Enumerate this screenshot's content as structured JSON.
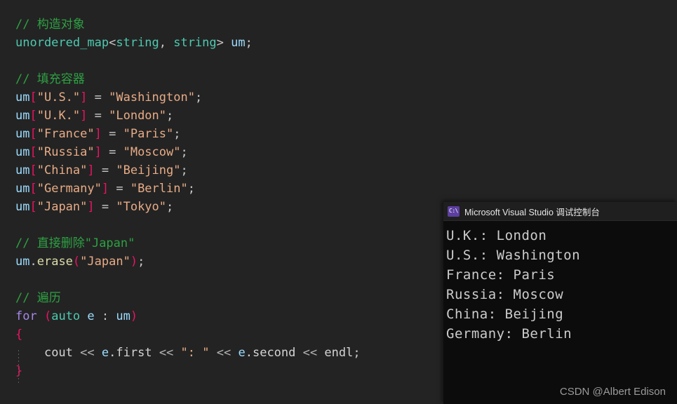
{
  "editor": {
    "language": "cpp",
    "background_color": "#232323",
    "lines": [
      {
        "id": "l1",
        "type": "comment",
        "text": "// 构造对象"
      },
      {
        "id": "l2",
        "type": "code",
        "text": "unordered_map<string, string> um;"
      },
      {
        "id": "l3",
        "type": "blank",
        "text": ""
      },
      {
        "id": "l4",
        "type": "comment",
        "text": "// 填充容器"
      },
      {
        "id": "l5",
        "type": "code",
        "text": "um[\"U.S.\"] = \"Washington\";"
      },
      {
        "id": "l6",
        "type": "code",
        "text": "um[\"U.K.\"] = \"London\";"
      },
      {
        "id": "l7",
        "type": "code",
        "text": "um[\"France\"] = \"Paris\";"
      },
      {
        "id": "l8",
        "type": "code",
        "text": "um[\"Russia\"] = \"Moscow\";"
      },
      {
        "id": "l9",
        "type": "code",
        "text": "um[\"China\"] = \"Beijing\";"
      },
      {
        "id": "l10",
        "type": "code",
        "text": "um[\"Germany\"] = \"Berlin\";"
      },
      {
        "id": "l11",
        "type": "code",
        "text": "um[\"Japan\"] = \"Tokyo\";"
      },
      {
        "id": "l12",
        "type": "blank",
        "text": ""
      },
      {
        "id": "l13",
        "type": "comment",
        "text": "// 直接删除\"Japan\""
      },
      {
        "id": "l14",
        "type": "code",
        "text": "um.erase(\"Japan\");"
      },
      {
        "id": "l15",
        "type": "blank",
        "text": ""
      },
      {
        "id": "l16",
        "type": "comment",
        "text": "// 遍历"
      },
      {
        "id": "l17",
        "type": "code",
        "text": "for (auto e : um)"
      },
      {
        "id": "l18",
        "type": "code",
        "text": "{"
      },
      {
        "id": "l19",
        "type": "code",
        "text": "    cout << e.first << \": \" << e.second << endl;"
      },
      {
        "id": "l20",
        "type": "code",
        "text": "}"
      }
    ],
    "tokens": {
      "l1": [
        {
          "t": "// ",
          "c": "t-comment"
        },
        {
          "t": "构造对象",
          "c": "t-comment"
        }
      ],
      "l2": [
        {
          "t": "unordered_map",
          "c": "t-type"
        },
        {
          "t": "<",
          "c": "t-punct"
        },
        {
          "t": "string",
          "c": "t-type"
        },
        {
          "t": ", ",
          "c": "t-punct"
        },
        {
          "t": "string",
          "c": "t-type"
        },
        {
          "t": "> ",
          "c": "t-punct"
        },
        {
          "t": "um",
          "c": "t-var"
        },
        {
          "t": ";",
          "c": "t-punct"
        }
      ],
      "l4": [
        {
          "t": "// ",
          "c": "t-comment"
        },
        {
          "t": "填充容器",
          "c": "t-comment"
        }
      ],
      "l5": [
        {
          "t": "um",
          "c": "t-var"
        },
        {
          "t": "[",
          "c": "t-bracket"
        },
        {
          "t": "\"U.S.\"",
          "c": "t-string"
        },
        {
          "t": "]",
          "c": "t-bracket"
        },
        {
          "t": " = ",
          "c": "t-punct"
        },
        {
          "t": "\"Washington\"",
          "c": "t-string"
        },
        {
          "t": ";",
          "c": "t-punct"
        }
      ],
      "l6": [
        {
          "t": "um",
          "c": "t-var"
        },
        {
          "t": "[",
          "c": "t-bracket"
        },
        {
          "t": "\"U.K.\"",
          "c": "t-string"
        },
        {
          "t": "]",
          "c": "t-bracket"
        },
        {
          "t": " = ",
          "c": "t-punct"
        },
        {
          "t": "\"London\"",
          "c": "t-string"
        },
        {
          "t": ";",
          "c": "t-punct"
        }
      ],
      "l7": [
        {
          "t": "um",
          "c": "t-var"
        },
        {
          "t": "[",
          "c": "t-bracket"
        },
        {
          "t": "\"France\"",
          "c": "t-string"
        },
        {
          "t": "]",
          "c": "t-bracket"
        },
        {
          "t": " = ",
          "c": "t-punct"
        },
        {
          "t": "\"Paris\"",
          "c": "t-string"
        },
        {
          "t": ";",
          "c": "t-punct"
        }
      ],
      "l8": [
        {
          "t": "um",
          "c": "t-var"
        },
        {
          "t": "[",
          "c": "t-bracket"
        },
        {
          "t": "\"Russia\"",
          "c": "t-string"
        },
        {
          "t": "]",
          "c": "t-bracket"
        },
        {
          "t": " = ",
          "c": "t-punct"
        },
        {
          "t": "\"Moscow\"",
          "c": "t-string"
        },
        {
          "t": ";",
          "c": "t-punct"
        }
      ],
      "l9": [
        {
          "t": "um",
          "c": "t-var"
        },
        {
          "t": "[",
          "c": "t-bracket"
        },
        {
          "t": "\"China\"",
          "c": "t-string"
        },
        {
          "t": "]",
          "c": "t-bracket"
        },
        {
          "t": " = ",
          "c": "t-punct"
        },
        {
          "t": "\"Beijing\"",
          "c": "t-string"
        },
        {
          "t": ";",
          "c": "t-punct"
        }
      ],
      "l10": [
        {
          "t": "um",
          "c": "t-var"
        },
        {
          "t": "[",
          "c": "t-bracket"
        },
        {
          "t": "\"Germany\"",
          "c": "t-string"
        },
        {
          "t": "]",
          "c": "t-bracket"
        },
        {
          "t": " = ",
          "c": "t-punct"
        },
        {
          "t": "\"Berlin\"",
          "c": "t-string"
        },
        {
          "t": ";",
          "c": "t-punct"
        }
      ],
      "l11": [
        {
          "t": "um",
          "c": "t-var"
        },
        {
          "t": "[",
          "c": "t-bracket"
        },
        {
          "t": "\"Japan\"",
          "c": "t-string"
        },
        {
          "t": "]",
          "c": "t-bracket"
        },
        {
          "t": " = ",
          "c": "t-punct"
        },
        {
          "t": "\"Tokyo\"",
          "c": "t-string"
        },
        {
          "t": ";",
          "c": "t-punct"
        }
      ],
      "l13": [
        {
          "t": "// ",
          "c": "t-comment"
        },
        {
          "t": "直接删除\"Japan\"",
          "c": "t-comment"
        }
      ],
      "l14": [
        {
          "t": "um",
          "c": "t-var"
        },
        {
          "t": ".",
          "c": "t-punct"
        },
        {
          "t": "erase",
          "c": "t-func"
        },
        {
          "t": "(",
          "c": "t-bracket"
        },
        {
          "t": "\"Japan\"",
          "c": "t-string"
        },
        {
          "t": ")",
          "c": "t-bracket"
        },
        {
          "t": ";",
          "c": "t-punct"
        }
      ],
      "l16": [
        {
          "t": "// ",
          "c": "t-comment"
        },
        {
          "t": "遍历",
          "c": "t-comment"
        }
      ],
      "l17": [
        {
          "t": "for",
          "c": "t-keyword"
        },
        {
          "t": " ",
          "c": "t-punct"
        },
        {
          "t": "(",
          "c": "t-bracket"
        },
        {
          "t": "auto",
          "c": "t-type"
        },
        {
          "t": " ",
          "c": "t-punct"
        },
        {
          "t": "e",
          "c": "t-var"
        },
        {
          "t": " : ",
          "c": "t-punct"
        },
        {
          "t": "um",
          "c": "t-var"
        },
        {
          "t": ")",
          "c": "t-bracket"
        }
      ],
      "l18": [
        {
          "t": "{",
          "c": "t-brace"
        }
      ],
      "l19": [
        {
          "t": "    ",
          "c": "t-punct"
        },
        {
          "t": "cout",
          "c": "t-plain"
        },
        {
          "t": " ",
          "c": "t-punct"
        },
        {
          "t": "<<",
          "c": "t-op"
        },
        {
          "t": " ",
          "c": "t-punct"
        },
        {
          "t": "e",
          "c": "t-var"
        },
        {
          "t": ".first",
          "c": "t-plain"
        },
        {
          "t": " ",
          "c": "t-punct"
        },
        {
          "t": "<<",
          "c": "t-op"
        },
        {
          "t": " ",
          "c": "t-punct"
        },
        {
          "t": "\": \"",
          "c": "t-string"
        },
        {
          "t": " ",
          "c": "t-punct"
        },
        {
          "t": "<<",
          "c": "t-op"
        },
        {
          "t": " ",
          "c": "t-punct"
        },
        {
          "t": "e",
          "c": "t-var"
        },
        {
          "t": ".second",
          "c": "t-plain"
        },
        {
          "t": " ",
          "c": "t-punct"
        },
        {
          "t": "<<",
          "c": "t-op"
        },
        {
          "t": " ",
          "c": "t-punct"
        },
        {
          "t": "endl",
          "c": "t-plain"
        },
        {
          "t": ";",
          "c": "t-punct"
        }
      ],
      "l20": [
        {
          "t": "}",
          "c": "t-brace"
        }
      ]
    }
  },
  "console": {
    "title": "Microsoft Visual Studio 调试控制台",
    "icon": "console-cmd-icon",
    "icon_glyph": "C:\\",
    "background_color": "#0c0c0c",
    "titlebar_color": "#1f1f1f",
    "output_lines": [
      "U.K.: London",
      "U.S.: Washington",
      "France: Paris",
      "Russia: Moscow",
      "China: Beijing",
      "Germany: Berlin"
    ]
  },
  "watermark": {
    "text": "CSDN @Albert Edison",
    "color": "#9a9a9a"
  }
}
